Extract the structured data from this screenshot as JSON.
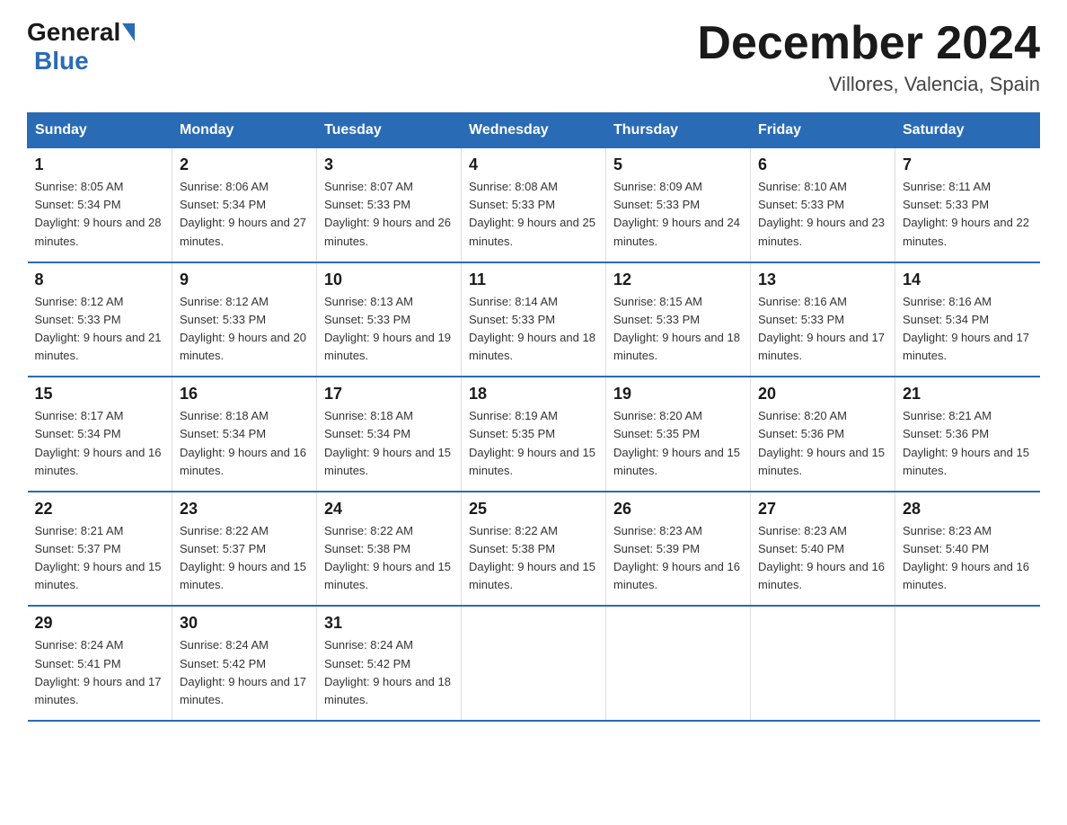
{
  "logo": {
    "general": "General",
    "blue": "Blue"
  },
  "header": {
    "title": "December 2024",
    "location": "Villores, Valencia, Spain"
  },
  "columns": [
    "Sunday",
    "Monday",
    "Tuesday",
    "Wednesday",
    "Thursday",
    "Friday",
    "Saturday"
  ],
  "weeks": [
    [
      {
        "day": "1",
        "sunrise": "8:05 AM",
        "sunset": "5:34 PM",
        "daylight": "9 hours and 28 minutes."
      },
      {
        "day": "2",
        "sunrise": "8:06 AM",
        "sunset": "5:34 PM",
        "daylight": "9 hours and 27 minutes."
      },
      {
        "day": "3",
        "sunrise": "8:07 AM",
        "sunset": "5:33 PM",
        "daylight": "9 hours and 26 minutes."
      },
      {
        "day": "4",
        "sunrise": "8:08 AM",
        "sunset": "5:33 PM",
        "daylight": "9 hours and 25 minutes."
      },
      {
        "day": "5",
        "sunrise": "8:09 AM",
        "sunset": "5:33 PM",
        "daylight": "9 hours and 24 minutes."
      },
      {
        "day": "6",
        "sunrise": "8:10 AM",
        "sunset": "5:33 PM",
        "daylight": "9 hours and 23 minutes."
      },
      {
        "day": "7",
        "sunrise": "8:11 AM",
        "sunset": "5:33 PM",
        "daylight": "9 hours and 22 minutes."
      }
    ],
    [
      {
        "day": "8",
        "sunrise": "8:12 AM",
        "sunset": "5:33 PM",
        "daylight": "9 hours and 21 minutes."
      },
      {
        "day": "9",
        "sunrise": "8:12 AM",
        "sunset": "5:33 PM",
        "daylight": "9 hours and 20 minutes."
      },
      {
        "day": "10",
        "sunrise": "8:13 AM",
        "sunset": "5:33 PM",
        "daylight": "9 hours and 19 minutes."
      },
      {
        "day": "11",
        "sunrise": "8:14 AM",
        "sunset": "5:33 PM",
        "daylight": "9 hours and 18 minutes."
      },
      {
        "day": "12",
        "sunrise": "8:15 AM",
        "sunset": "5:33 PM",
        "daylight": "9 hours and 18 minutes."
      },
      {
        "day": "13",
        "sunrise": "8:16 AM",
        "sunset": "5:33 PM",
        "daylight": "9 hours and 17 minutes."
      },
      {
        "day": "14",
        "sunrise": "8:16 AM",
        "sunset": "5:34 PM",
        "daylight": "9 hours and 17 minutes."
      }
    ],
    [
      {
        "day": "15",
        "sunrise": "8:17 AM",
        "sunset": "5:34 PM",
        "daylight": "9 hours and 16 minutes."
      },
      {
        "day": "16",
        "sunrise": "8:18 AM",
        "sunset": "5:34 PM",
        "daylight": "9 hours and 16 minutes."
      },
      {
        "day": "17",
        "sunrise": "8:18 AM",
        "sunset": "5:34 PM",
        "daylight": "9 hours and 15 minutes."
      },
      {
        "day": "18",
        "sunrise": "8:19 AM",
        "sunset": "5:35 PM",
        "daylight": "9 hours and 15 minutes."
      },
      {
        "day": "19",
        "sunrise": "8:20 AM",
        "sunset": "5:35 PM",
        "daylight": "9 hours and 15 minutes."
      },
      {
        "day": "20",
        "sunrise": "8:20 AM",
        "sunset": "5:36 PM",
        "daylight": "9 hours and 15 minutes."
      },
      {
        "day": "21",
        "sunrise": "8:21 AM",
        "sunset": "5:36 PM",
        "daylight": "9 hours and 15 minutes."
      }
    ],
    [
      {
        "day": "22",
        "sunrise": "8:21 AM",
        "sunset": "5:37 PM",
        "daylight": "9 hours and 15 minutes."
      },
      {
        "day": "23",
        "sunrise": "8:22 AM",
        "sunset": "5:37 PM",
        "daylight": "9 hours and 15 minutes."
      },
      {
        "day": "24",
        "sunrise": "8:22 AM",
        "sunset": "5:38 PM",
        "daylight": "9 hours and 15 minutes."
      },
      {
        "day": "25",
        "sunrise": "8:22 AM",
        "sunset": "5:38 PM",
        "daylight": "9 hours and 15 minutes."
      },
      {
        "day": "26",
        "sunrise": "8:23 AM",
        "sunset": "5:39 PM",
        "daylight": "9 hours and 16 minutes."
      },
      {
        "day": "27",
        "sunrise": "8:23 AM",
        "sunset": "5:40 PM",
        "daylight": "9 hours and 16 minutes."
      },
      {
        "day": "28",
        "sunrise": "8:23 AM",
        "sunset": "5:40 PM",
        "daylight": "9 hours and 16 minutes."
      }
    ],
    [
      {
        "day": "29",
        "sunrise": "8:24 AM",
        "sunset": "5:41 PM",
        "daylight": "9 hours and 17 minutes."
      },
      {
        "day": "30",
        "sunrise": "8:24 AM",
        "sunset": "5:42 PM",
        "daylight": "9 hours and 17 minutes."
      },
      {
        "day": "31",
        "sunrise": "8:24 AM",
        "sunset": "5:42 PM",
        "daylight": "9 hours and 18 minutes."
      },
      null,
      null,
      null,
      null
    ]
  ]
}
